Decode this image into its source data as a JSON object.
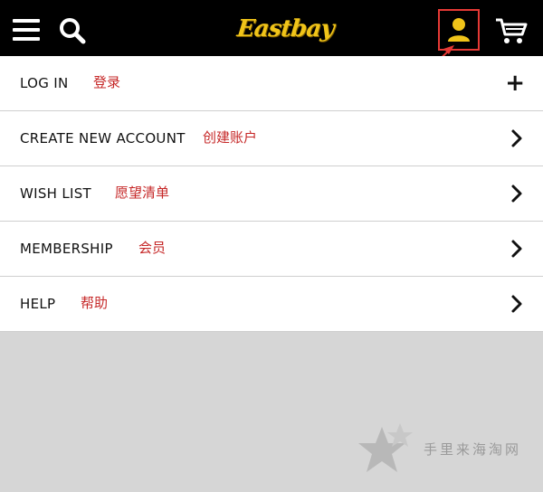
{
  "header": {
    "logo_text": "Eastbay",
    "icons": [
      "menu-icon",
      "search-icon",
      "user-icon",
      "cart-icon"
    ],
    "colors": {
      "background": "#000000",
      "accent": "#f0c419",
      "highlight": "#e53935"
    }
  },
  "menu": {
    "items": [
      {
        "label": "LOG IN",
        "note": "登录",
        "action": "plus-icon"
      },
      {
        "label": "CREATE NEW ACCOUNT",
        "note": "创建账户",
        "action": "chevron-right-icon"
      },
      {
        "label": "WISH LIST",
        "note": "愿望清单",
        "action": "chevron-right-icon"
      },
      {
        "label": "MEMBERSHIP",
        "note": "会员",
        "action": "chevron-right-icon"
      },
      {
        "label": "HELP",
        "note": "帮助",
        "action": "chevron-right-icon"
      }
    ]
  },
  "watermark": {
    "text": "手里来海淘网"
  }
}
